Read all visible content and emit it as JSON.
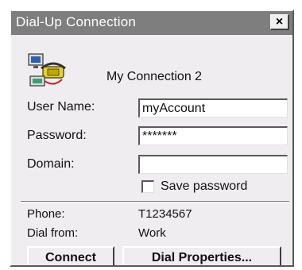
{
  "window": {
    "title": "Dial-Up Connection",
    "close_label": "×"
  },
  "connection": {
    "name": "My Connection 2",
    "icon": "dial-up-connection-icon"
  },
  "form": {
    "username_label": "User Name:",
    "username_value": "myAccount",
    "password_label": "Password:",
    "password_value": "*******",
    "domain_label": "Domain:",
    "domain_value": "",
    "save_password_label": "Save password",
    "save_password_checked": false
  },
  "info": {
    "phone_label": "Phone:",
    "phone_value": "T1234567",
    "dial_from_label": "Dial from:",
    "dial_from_value": "Work"
  },
  "buttons": {
    "connect": "Connect",
    "dial_properties": "Dial Properties..."
  }
}
